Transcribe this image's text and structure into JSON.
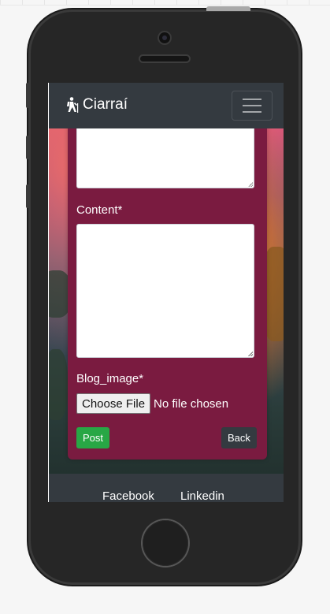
{
  "navbar": {
    "brand": "Ciarraí",
    "brand_icon": "hiking-icon",
    "menu_icon": "hamburger-icon"
  },
  "form": {
    "title_value": "",
    "content_label": "Content*",
    "content_value": "",
    "image_label": "Blog_image*",
    "file_button": "Choose File",
    "file_status": "No file chosen",
    "post_button": "Post",
    "back_button": "Back"
  },
  "footer": {
    "links": [
      "Facebook",
      "Linkedin"
    ]
  },
  "colors": {
    "navbar": "#343a40",
    "card": "#7a1b40",
    "post": "#28a745",
    "back": "#343a40"
  }
}
